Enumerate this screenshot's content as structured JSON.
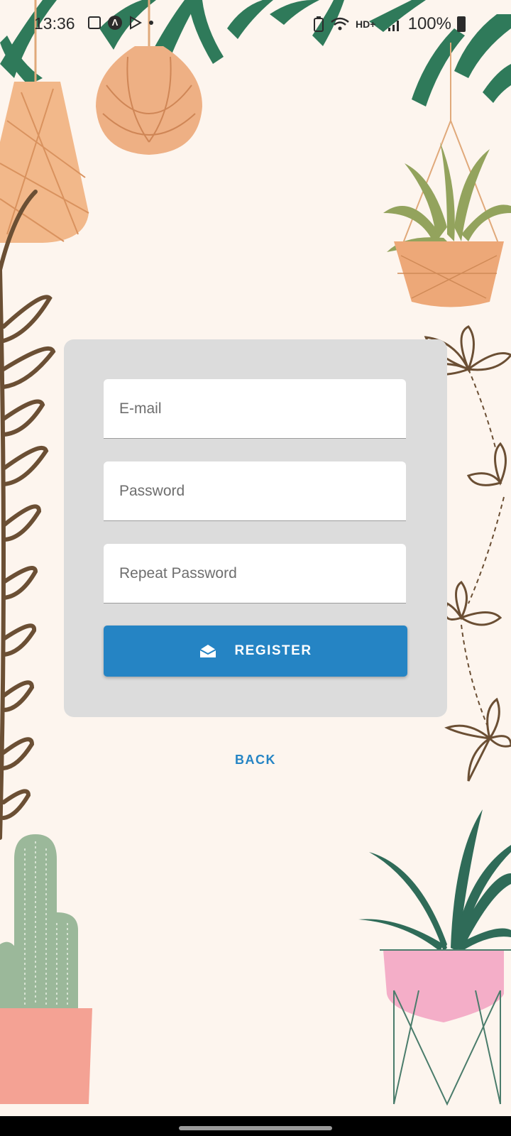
{
  "status_bar": {
    "time": "13:36",
    "battery": "100%",
    "left_icons": [
      "gallery-icon",
      "app-a-icon",
      "play-store-icon",
      "notification-dot-icon"
    ],
    "right_icons": [
      "battery-saver-icon",
      "wifi-icon",
      "hd-signal-icon",
      "cell-signal-icon",
      "battery-icon"
    ]
  },
  "form": {
    "email_placeholder": "E-mail",
    "password_placeholder": "Password",
    "repeat_password_placeholder": "Repeat Password",
    "register_label": "REGISTER",
    "register_icon": "open-envelope-icon"
  },
  "back_label": "BACK",
  "colors": {
    "background": "#fdf5ee",
    "card": "#dcdcdc",
    "accent": "#2584c4"
  }
}
